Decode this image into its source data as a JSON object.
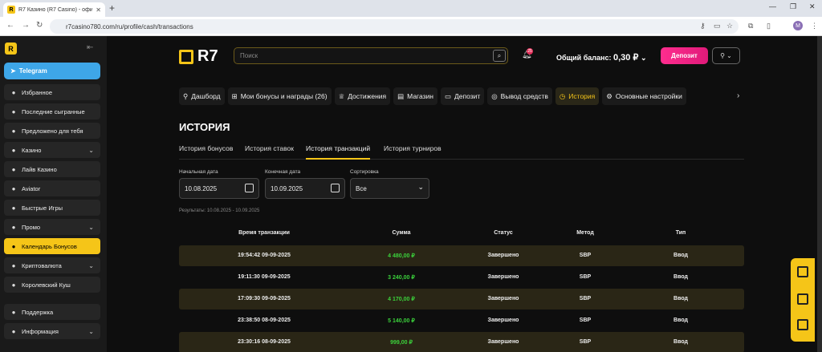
{
  "browser": {
    "tab_title": "R7 Казино (R7 Casino) - офици",
    "url": "r7casino780.com/ru/profile/cash/transactions",
    "profile_initial": "M"
  },
  "sidebar": {
    "telegram": "Telegram",
    "items": [
      {
        "label": "Избранное",
        "icon": "heart-icon",
        "chev": false
      },
      {
        "label": "Последние сыгранные",
        "icon": "clock-icon",
        "chev": false
      },
      {
        "label": "Предложено для тебя",
        "icon": "flame-icon",
        "chev": false
      },
      {
        "label": "Казино",
        "icon": "casino-icon",
        "chev": true
      },
      {
        "label": "Лайв Казино",
        "icon": "live-icon",
        "chev": false
      },
      {
        "label": "Aviator",
        "icon": "plane-icon",
        "chev": false
      },
      {
        "label": "Быстрые Игры",
        "icon": "rocket-icon",
        "chev": false
      },
      {
        "label": "Промо",
        "icon": "promo-icon",
        "chev": true
      },
      {
        "label": "Календарь Бонусов",
        "icon": "calendar-icon",
        "chev": false
      },
      {
        "label": "Криптовалюта",
        "icon": "crypto-icon",
        "chev": true
      },
      {
        "label": "Королевский Куш",
        "icon": "diamond-icon",
        "chev": false
      },
      {
        "label": "Поддержка",
        "icon": "chat-icon",
        "chev": false
      },
      {
        "label": "Информация",
        "icon": "info-icon",
        "chev": true
      }
    ]
  },
  "header": {
    "brand": "R7",
    "search_placeholder": "Поиск",
    "notification_count": "25",
    "balance_label": "Общий баланс:",
    "balance_value": "0,30 ₽",
    "deposit_label": "Депозит"
  },
  "nav_tabs": [
    {
      "label": "Дашборд",
      "icon": "user-icon"
    },
    {
      "label": "Мои бонусы и награды (26)",
      "icon": "gift-icon"
    },
    {
      "label": "Достижения",
      "icon": "trophy-icon"
    },
    {
      "label": "Магазин",
      "icon": "store-icon"
    },
    {
      "label": "Депозит",
      "icon": "card-icon"
    },
    {
      "label": "Вывод средств",
      "icon": "coins-icon"
    },
    {
      "label": "История",
      "icon": "history-icon"
    },
    {
      "label": "Основные настройки",
      "icon": "settings-icon"
    }
  ],
  "page": {
    "title": "ИСТОРИЯ",
    "subtabs": [
      "История бонусов",
      "История ставок",
      "История транзакций",
      "История турниров"
    ],
    "filters": {
      "start_label": "Начальная дата",
      "start_value": "10.08.2025",
      "end_label": "Конечная дата",
      "end_value": "10.09.2025",
      "sort_label": "Сортировка",
      "sort_value": "Все"
    },
    "results": "Результаты: 10.08.2025 - 10.09.2025"
  },
  "table": {
    "headers": [
      "Время транзакции",
      "Сумма",
      "Статус",
      "Метод",
      "Тип"
    ],
    "rows": [
      [
        "19:54:42 09-09-2025",
        "4 480,00 ₽",
        "Завершено",
        "SBP",
        "Ввод"
      ],
      [
        "19:11:30 09-09-2025",
        "3 240,00 ₽",
        "Завершено",
        "SBP",
        "Ввод"
      ],
      [
        "17:09:30 09-09-2025",
        "4 170,00 ₽",
        "Завершено",
        "SBP",
        "Ввод"
      ],
      [
        "23:38:50 08-09-2025",
        "5 140,00 ₽",
        "Завершено",
        "SBP",
        "Ввод"
      ],
      [
        "23:30:16 08-09-2025",
        "999,00 ₽",
        "Завершено",
        "SBP",
        "Ввод"
      ]
    ]
  },
  "colors": {
    "accent": "#f5c518",
    "deposit": "#ff2d8e",
    "sum_green": "#3bd13b",
    "stripe": "#2a2616"
  }
}
